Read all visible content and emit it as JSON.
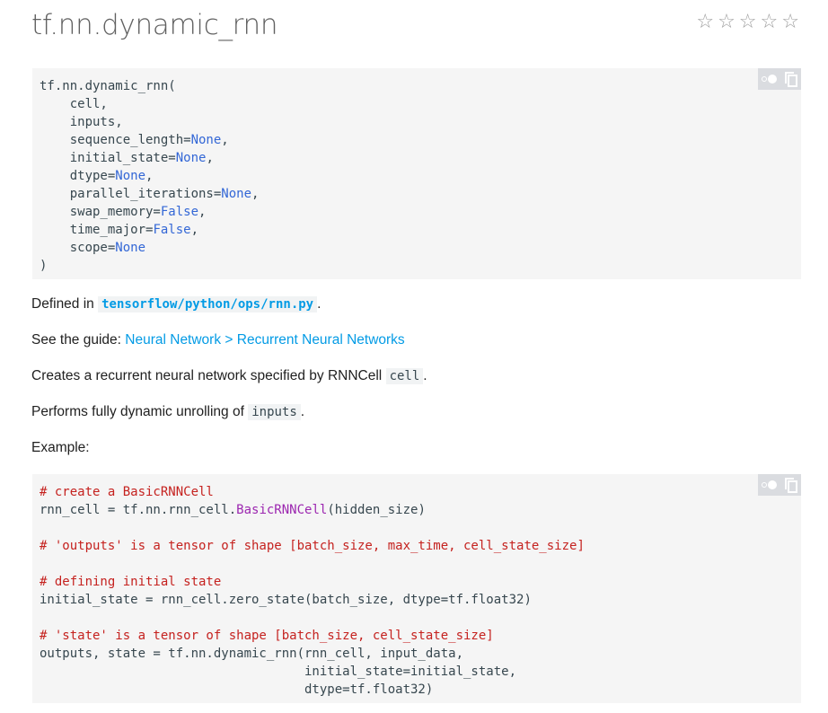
{
  "page": {
    "title": "tf.nn.dynamic_rnn",
    "rating": {
      "stars": [
        "☆",
        "☆",
        "☆",
        "☆",
        "☆"
      ],
      "value": 0
    }
  },
  "signature_block": {
    "tools": {
      "toggle_icon": "toggle-icon",
      "copy_icon": "copy-icon"
    },
    "lines": [
      [
        {
          "t": "plain",
          "v": "tf.nn.dynamic_rnn("
        }
      ],
      [
        {
          "t": "plain",
          "v": "    cell,"
        }
      ],
      [
        {
          "t": "plain",
          "v": "    inputs,"
        }
      ],
      [
        {
          "t": "plain",
          "v": "    sequence_length="
        },
        {
          "t": "kw",
          "v": "None"
        },
        {
          "t": "plain",
          "v": ","
        }
      ],
      [
        {
          "t": "plain",
          "v": "    initial_state="
        },
        {
          "t": "kw",
          "v": "None"
        },
        {
          "t": "plain",
          "v": ","
        }
      ],
      [
        {
          "t": "plain",
          "v": "    dtype="
        },
        {
          "t": "kw",
          "v": "None"
        },
        {
          "t": "plain",
          "v": ","
        }
      ],
      [
        {
          "t": "plain",
          "v": "    parallel_iterations="
        },
        {
          "t": "kw",
          "v": "None"
        },
        {
          "t": "plain",
          "v": ","
        }
      ],
      [
        {
          "t": "plain",
          "v": "    swap_memory="
        },
        {
          "t": "kw",
          "v": "False"
        },
        {
          "t": "plain",
          "v": ","
        }
      ],
      [
        {
          "t": "plain",
          "v": "    time_major="
        },
        {
          "t": "kw",
          "v": "False"
        },
        {
          "t": "plain",
          "v": ","
        }
      ],
      [
        {
          "t": "plain",
          "v": "    scope="
        },
        {
          "t": "kw",
          "v": "None"
        }
      ],
      [
        {
          "t": "plain",
          "v": ")"
        }
      ]
    ]
  },
  "defined_in": {
    "prefix": "Defined in ",
    "link": "tensorflow/python/ops/rnn.py",
    "suffix": "."
  },
  "see_guide": {
    "prefix": "See the guide: ",
    "link": "Neural Network > Recurrent Neural Networks"
  },
  "creates": {
    "prefix": "Creates a recurrent neural network specified by RNNCell ",
    "code": "cell",
    "suffix": "."
  },
  "performs": {
    "prefix": "Performs fully dynamic unrolling of ",
    "code": "inputs",
    "suffix": "."
  },
  "example_label": "Example:",
  "example_block": {
    "tools": {
      "toggle_icon": "toggle-icon",
      "copy_icon": "copy-icon"
    },
    "lines": [
      [
        {
          "t": "cm",
          "v": "# create a BasicRNNCell"
        }
      ],
      [
        {
          "t": "plain",
          "v": "rnn_cell = tf.nn.rnn_cell."
        },
        {
          "t": "cls",
          "v": "BasicRNNCell"
        },
        {
          "t": "plain",
          "v": "(hidden_size)"
        }
      ],
      [
        {
          "t": "plain",
          "v": ""
        }
      ],
      [
        {
          "t": "cm",
          "v": "# 'outputs' is a tensor of shape [batch_size, max_time, cell_state_size]"
        }
      ],
      [
        {
          "t": "plain",
          "v": ""
        }
      ],
      [
        {
          "t": "cm",
          "v": "# defining initial state"
        }
      ],
      [
        {
          "t": "plain",
          "v": "initial_state = rnn_cell.zero_state(batch_size, dtype=tf.float32)"
        }
      ],
      [
        {
          "t": "plain",
          "v": ""
        }
      ],
      [
        {
          "t": "cm",
          "v": "# 'state' is a tensor of shape [batch_size, cell_state_size]"
        }
      ],
      [
        {
          "t": "plain",
          "v": "outputs, state = tf.nn.dynamic_rnn(rnn_cell, input_data,"
        }
      ],
      [
        {
          "t": "plain",
          "v": "                                   initial_state=initial_state,"
        }
      ],
      [
        {
          "t": "plain",
          "v": "                                   dtype=tf.float32)"
        }
      ]
    ]
  }
}
